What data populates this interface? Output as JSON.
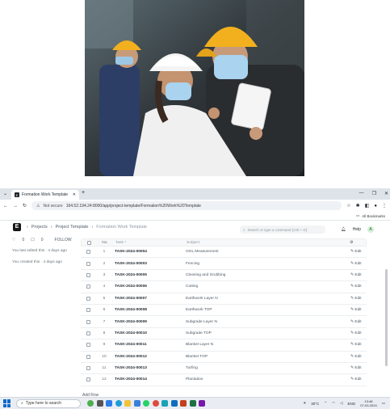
{
  "browser": {
    "tab_title": "Formation Work Template",
    "favicon_letter": "E",
    "new_tab": "+",
    "not_secure": "Not secure",
    "url": "164.52.194.24:8000/app/project-template/Formation%20Work%20Template",
    "bookmarks_label": "All Bookmarks"
  },
  "app": {
    "logo_letter": "E",
    "breadcrumbs": [
      "Projects",
      "Project Template",
      "Formation Work Template"
    ],
    "search_placeholder": "Search or type a command (Ctrl + G)",
    "help_label": "Help",
    "avatar_letter": "A"
  },
  "sidebar": {
    "likes": "0",
    "comments": "0",
    "follow_label": "FOLLOW",
    "last_edited": "You last edited this · 4 days ago",
    "created": "You created this · 4 days ago"
  },
  "grid": {
    "headers": {
      "no": "No.",
      "task": "Task *",
      "subject": "Subject"
    },
    "edit_label": "Edit",
    "rows": [
      {
        "no": "1",
        "task": "TASK-2024-00004",
        "subject": "OGL Measurement"
      },
      {
        "no": "2",
        "task": "TASK-2024-00003",
        "subject": "Fencing"
      },
      {
        "no": "3",
        "task": "TASK-2024-00005",
        "subject": "Cleaning and Grubbing"
      },
      {
        "no": "4",
        "task": "TASK-2024-00006",
        "subject": "Cutting"
      },
      {
        "no": "5",
        "task": "TASK-2024-00007",
        "subject": "Earthwork Layer N"
      },
      {
        "no": "6",
        "task": "TASK-2024-00008",
        "subject": "Earthwork TOP"
      },
      {
        "no": "7",
        "task": "TASK-2024-00009",
        "subject": "Subgrade Layer N"
      },
      {
        "no": "8",
        "task": "TASK-2024-00010",
        "subject": "Subgrade TOP"
      },
      {
        "no": "9",
        "task": "TASK-2024-00011",
        "subject": "Blanket Layer N"
      },
      {
        "no": "10",
        "task": "TASK-2024-00012",
        "subject": "Blanket TOP"
      },
      {
        "no": "11",
        "task": "TASK-2024-00013",
        "subject": "Turfing"
      },
      {
        "no": "12",
        "task": "TASK-2024-00014",
        "subject": "Plantation"
      }
    ],
    "add_row": "Add Row"
  },
  "taskbar": {
    "search_placeholder": "Type here to search",
    "temperature": "30°C",
    "language": "ENG",
    "time": "13:48",
    "date": "07-03-2024"
  },
  "colors": {
    "helmet": "#f2b01e",
    "white_helmet": "#f4f4f4",
    "accent": "#0a67c9"
  }
}
